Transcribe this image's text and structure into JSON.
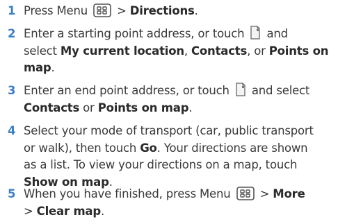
{
  "steps": [
    {
      "number": "1",
      "lines": [
        {
          "pre": "Press Menu ",
          "mid": " > ",
          "bold": "Directions",
          "post": "."
        }
      ]
    },
    {
      "number": "2",
      "line1": "Enter a starting point address, or touch ",
      "line1_end": " and",
      "line2_pre": "select ",
      "line2_b1": "My current location",
      "line2_sep": ", ",
      "line2_b2": "Contacts",
      "line2_mid": ", or ",
      "line2_b3": "Points on",
      "line3_b": "map",
      "line3_post": "."
    },
    {
      "number": "3",
      "line1": "Enter an end point address, or touch ",
      "line1_end": " and select",
      "line2_b1": "Contacts",
      "line2_mid": " or ",
      "line2_b2": "Points on map",
      "line2_post": "."
    },
    {
      "number": "4",
      "line1": "Select your mode of transport (car, public transport",
      "line2_pre": "or walk), then touch ",
      "line2_b": "Go",
      "line2_post": ". Your directions are shown",
      "line3": "as a list. To view your directions on a map, touch",
      "line4_b": "Show on map",
      "line4_post": "."
    },
    {
      "number": "5",
      "line1": "When you have finished, press Menu ",
      "line1_mid": " > ",
      "line1_b": "More",
      "line2_pre": "> ",
      "line2_b": "Clear map",
      "line2_post": "."
    }
  ],
  "icons": {
    "menu": "menu-key-icon",
    "contacts": "contacts-picker-icon"
  }
}
